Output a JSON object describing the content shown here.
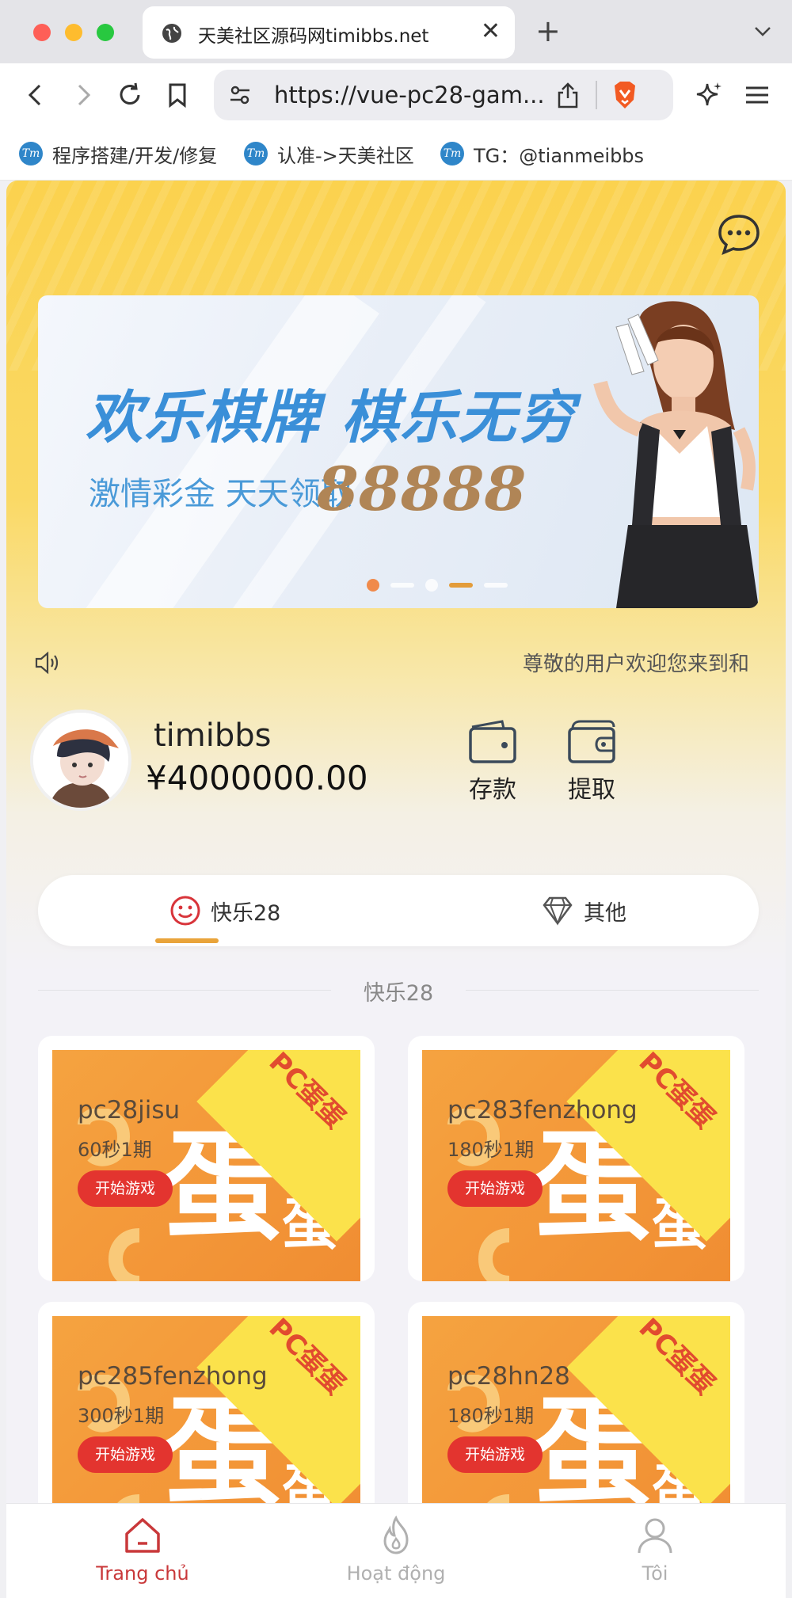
{
  "browser": {
    "tab_title": "天美社区源码网timibbs.net",
    "url": "https://vue-pc28-gam...",
    "bookmarks": [
      {
        "label": "程序搭建/开发/修复",
        "icon": "tm-logo-icon"
      },
      {
        "label": "认准->天美社区",
        "icon": "tm-logo-icon"
      },
      {
        "label": "TG：@tianmeibbs",
        "icon": "tm-logo-icon"
      }
    ],
    "bookmark_logo_text": "Tm"
  },
  "banner": {
    "headline": "欢乐棋牌 棋乐无穷",
    "subline": "激情彩金 天天领取",
    "number": "88888",
    "slide_count": 5,
    "active_slide": 1
  },
  "notice": {
    "text": "尊敬的用户欢迎您来到和"
  },
  "user": {
    "name": "timibbs",
    "balance": "¥4000000.00",
    "deposit_label": "存款",
    "withdraw_label": "提取"
  },
  "category_tabs": [
    {
      "label": "快乐28",
      "icon": "smile-icon",
      "active": true
    },
    {
      "label": "其他",
      "icon": "diamond-icon",
      "active": false
    }
  ],
  "section_title": "快乐28",
  "games": [
    {
      "name": "pc28jisu",
      "period": "60秒1期",
      "button": "开始游戏",
      "badge": "PC蛋蛋"
    },
    {
      "name": "pc283fenzhong",
      "period": "180秒1期",
      "button": "开始游戏",
      "badge": "PC蛋蛋"
    },
    {
      "name": "pc285fenzhong",
      "period": "300秒1期",
      "button": "开始游戏",
      "badge": "PC蛋蛋"
    },
    {
      "name": "pc28hn28",
      "period": "180秒1期",
      "button": "开始游戏",
      "badge": "PC蛋蛋"
    }
  ],
  "bottom_nav": [
    {
      "label": "Trang chủ",
      "icon": "home-icon",
      "active": true
    },
    {
      "label": "Hoạt động",
      "icon": "flame-icon",
      "active": false
    },
    {
      "label": "Tôi",
      "icon": "user-icon",
      "active": false
    }
  ],
  "colors": {
    "accent": "#e3342f",
    "nav_active": "#c9383a",
    "nav_inactive": "#b0b0b0",
    "tab_underline": "#e9a43a",
    "card_orange": "#f39638",
    "card_corner": "#fbe24b"
  }
}
